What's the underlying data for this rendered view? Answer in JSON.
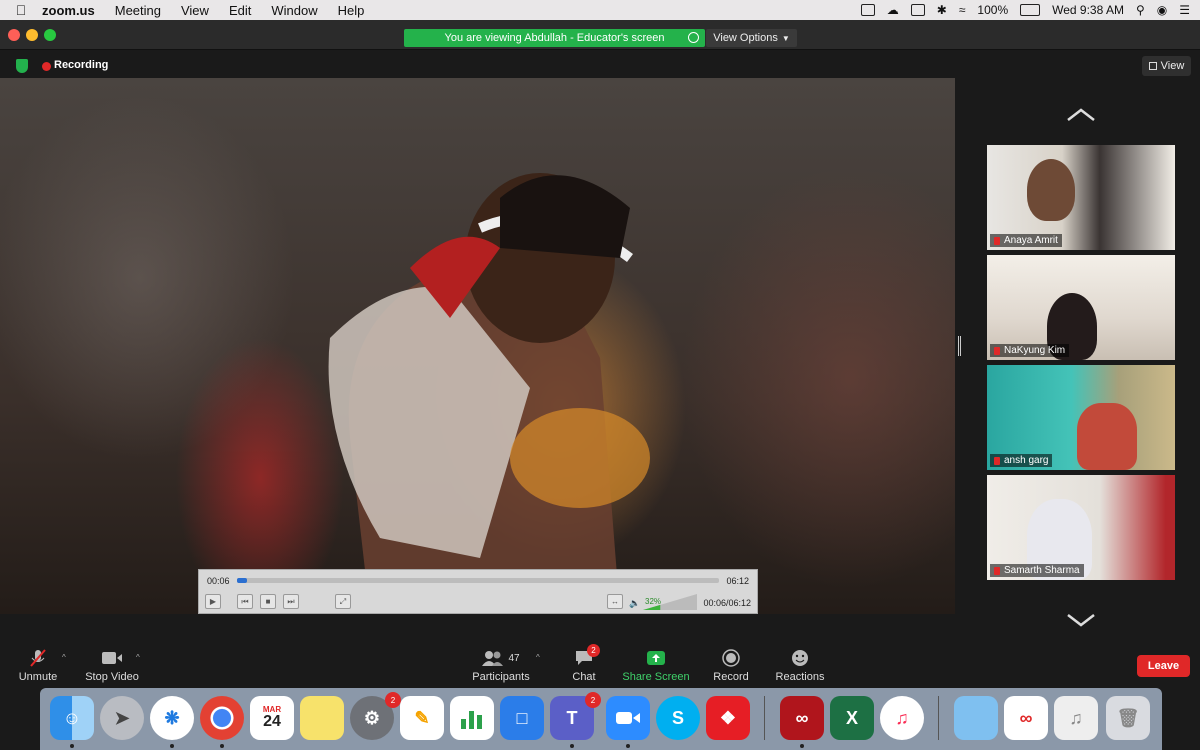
{
  "menubar": {
    "app": "zoom.us",
    "menus": [
      "Meeting",
      "View",
      "Edit",
      "Window",
      "Help"
    ],
    "battery": "100%",
    "clock": "Wed 9:38 AM"
  },
  "banner": {
    "viewing": "You are viewing Abdullah - Educator's screen",
    "view_options": "View Options"
  },
  "top": {
    "recording": "Recording",
    "view": "View"
  },
  "video_player": {
    "elapsed": "00:06",
    "duration": "06:12",
    "position": "00:06/06:12",
    "volume": "32%",
    "progress": 0.02
  },
  "participants": [
    {
      "name": "Anaya Amrit"
    },
    {
      "name": "NaKyung Kim"
    },
    {
      "name": "ansh garg"
    },
    {
      "name": "Samarth Sharma"
    }
  ],
  "toolbar": {
    "unmute": "Unmute",
    "stop_video": "Stop Video",
    "participants": "Participants",
    "participants_count": "47",
    "chat": "Chat",
    "chat_badge": "2",
    "share_screen": "Share Screen",
    "record": "Record",
    "reactions": "Reactions",
    "leave": "Leave"
  },
  "dock": {
    "calendar_month": "MAR",
    "calendar_day": "24",
    "prefs_badge": "2",
    "chat_badge": "2",
    "teams_label": "T",
    "excel_label": "X",
    "skype_label": "S"
  },
  "colors": {
    "share_green": "#24b24b",
    "leave_red": "#e02828",
    "zoom_blue": "#2d8cff"
  }
}
